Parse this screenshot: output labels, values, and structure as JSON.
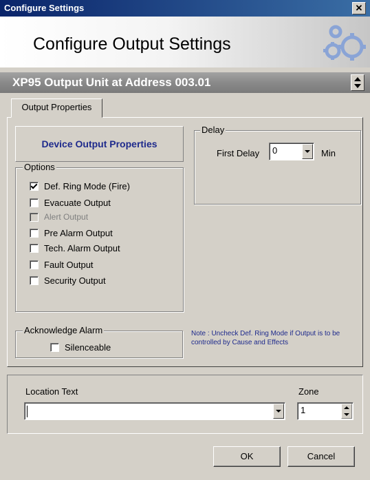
{
  "window": {
    "title": "Configure Settings",
    "close_symbol": "✕"
  },
  "banner": {
    "heading": "Configure Output Settings",
    "logo_icon": "gears-icon"
  },
  "device_bar": {
    "title": "XP95 Output Unit at Address 003.01"
  },
  "tabs": [
    {
      "label": "Output Properties",
      "selected": true
    }
  ],
  "device_output_properties": {
    "label": "Device Output Properties",
    "color": "#1e2a8c"
  },
  "options": {
    "legend": "Options",
    "items": [
      {
        "label": "Def. Ring Mode (Fire)",
        "checked": true,
        "enabled": true
      },
      {
        "label": "Evacuate Output",
        "checked": false,
        "enabled": true
      },
      {
        "label": "Alert Output",
        "checked": false,
        "enabled": false
      },
      {
        "label": "Pre Alarm Output",
        "checked": false,
        "enabled": true
      },
      {
        "label": "Tech. Alarm Output",
        "checked": false,
        "enabled": true
      },
      {
        "label": "Fault Output",
        "checked": false,
        "enabled": true
      },
      {
        "label": "Security Output",
        "checked": false,
        "enabled": true
      }
    ]
  },
  "delay": {
    "legend": "Delay",
    "first_delay_label": "First Delay",
    "first_delay_value": "0",
    "unit": "Min"
  },
  "acknowledge": {
    "legend": "Acknowledge Alarm",
    "silenceable_label": "Silenceable",
    "silenceable_checked": false
  },
  "note": {
    "text": "Note : Uncheck Def. Ring Mode if Output is to be controlled by Cause and Effects"
  },
  "location": {
    "label": "Location Text",
    "value": ""
  },
  "zone": {
    "label": "Zone",
    "value": "1"
  },
  "buttons": {
    "ok": "OK",
    "cancel": "Cancel"
  }
}
